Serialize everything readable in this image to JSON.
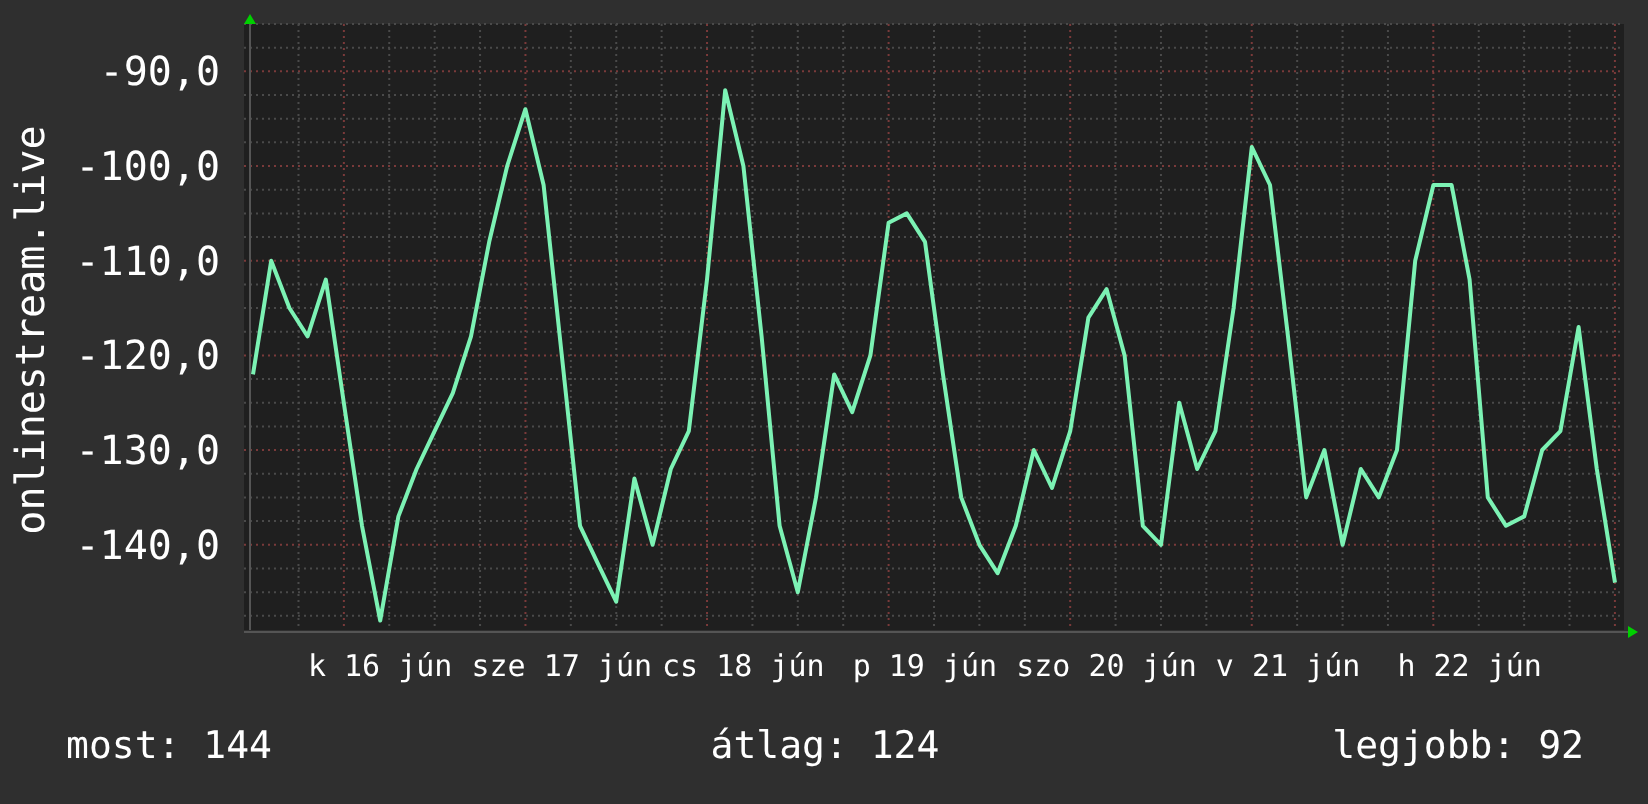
{
  "graph": {
    "chart_data": {
      "type": "line",
      "grid": true,
      "ylabel": "onlinestream.live",
      "ylim": [
        -149,
        -85
      ],
      "yticks": [
        {
          "value": -90,
          "label": "-90,0"
        },
        {
          "value": -100,
          "label": "-100,0"
        },
        {
          "value": -110,
          "label": "-110,0"
        },
        {
          "value": -120,
          "label": "-120,0"
        },
        {
          "value": -130,
          "label": "-130,0"
        },
        {
          "value": -140,
          "label": "-140,0"
        }
      ],
      "categories": [
        null,
        null,
        null,
        null,
        null,
        null,
        null,
        "k 16 jún",
        null,
        null,
        null,
        null,
        null,
        null,
        null,
        null,
        null,
        "sze 17 jún",
        null,
        null,
        null,
        null,
        null,
        null,
        null,
        null,
        null,
        "cs 18 jún",
        null,
        null,
        null,
        null,
        null,
        null,
        null,
        null,
        null,
        "p 19 jún",
        null,
        null,
        null,
        null,
        null,
        null,
        null,
        null,
        null,
        "szo 20 jún",
        null,
        null,
        null,
        null,
        null,
        null,
        null,
        null,
        null,
        "v 21 jún",
        null,
        null,
        null,
        null,
        null,
        null,
        null,
        null,
        null,
        "h 22 jún",
        null,
        null,
        null,
        null,
        null,
        null,
        null,
        null
      ],
      "values": [
        -122,
        -110,
        -115,
        -118,
        -112,
        -125,
        -138,
        -148,
        -137,
        -132,
        -128,
        -124,
        -118,
        -108,
        -100,
        -94,
        -102,
        -120,
        -138,
        -142,
        -146,
        -133,
        -140,
        -132,
        -128,
        -112,
        -92,
        -100,
        -118,
        -138,
        -145,
        -135,
        -122,
        -126,
        -120,
        -106,
        -105,
        -108,
        -122,
        -135,
        -140,
        -143,
        -138,
        -130,
        -134,
        -128,
        -116,
        -113,
        -120,
        -138,
        -140,
        -125,
        -132,
        -128,
        -115,
        -98,
        -102,
        -118,
        -135,
        -130,
        -140,
        -132,
        -135,
        -130,
        -110,
        -102,
        -102,
        -112,
        -135,
        -138,
        -137,
        -130,
        -128,
        -117,
        -132,
        -144
      ]
    }
  },
  "legend": [
    "most: 144",
    "átlag: 124",
    "legjobb: 92"
  ]
}
